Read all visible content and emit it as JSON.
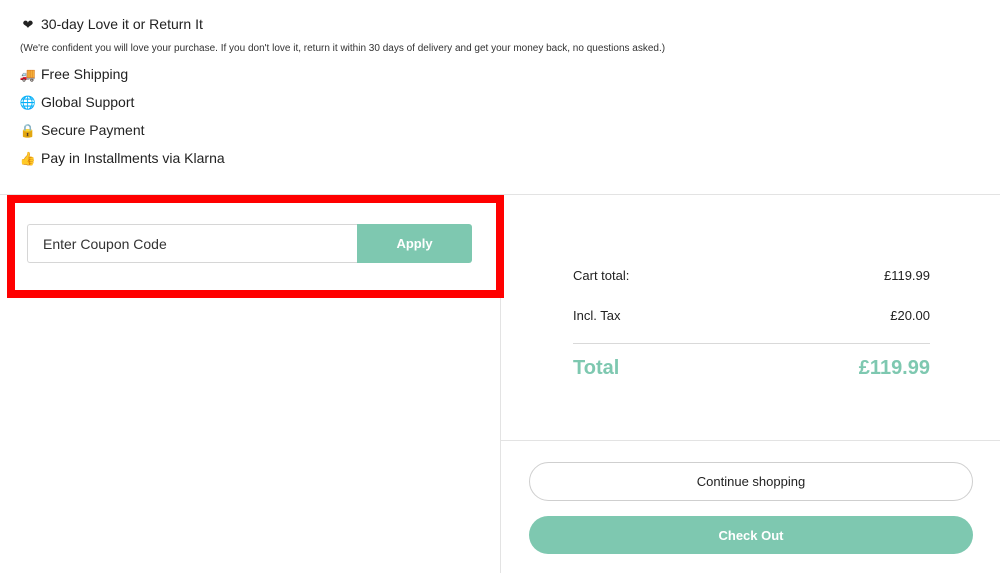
{
  "perks": {
    "guarantee": {
      "icon": "heart-icon",
      "glyph": "❤",
      "label": "30-day Love it or Return It"
    },
    "guarantee_note": "(We're confident you will love your purchase. If you don't love it, return it within 30 days of delivery and get your money back, no questions asked.)",
    "items": [
      {
        "icon": "truck-icon",
        "glyph": "🚚",
        "label": "Free Shipping"
      },
      {
        "icon": "globe-icon",
        "glyph": "🌐",
        "label": "Global Support"
      },
      {
        "icon": "lock-icon",
        "glyph": "🔒",
        "label": "Secure Payment"
      },
      {
        "icon": "thumbs-up-icon",
        "glyph": "👍",
        "label": "Pay in Installments via Klarna"
      }
    ]
  },
  "coupon": {
    "placeholder": "Enter Coupon Code",
    "value": "",
    "apply_label": "Apply"
  },
  "summary": {
    "cart_total_label": "Cart total:",
    "cart_total_value": "£119.99",
    "tax_label": "Incl. Tax",
    "tax_value": "£20.00",
    "total_label": "Total",
    "total_value": "£119.99"
  },
  "actions": {
    "continue_label": "Continue shopping",
    "checkout_label": "Check Out"
  },
  "colors": {
    "accent": "#7ec8b0",
    "highlight": "#ff0000"
  }
}
